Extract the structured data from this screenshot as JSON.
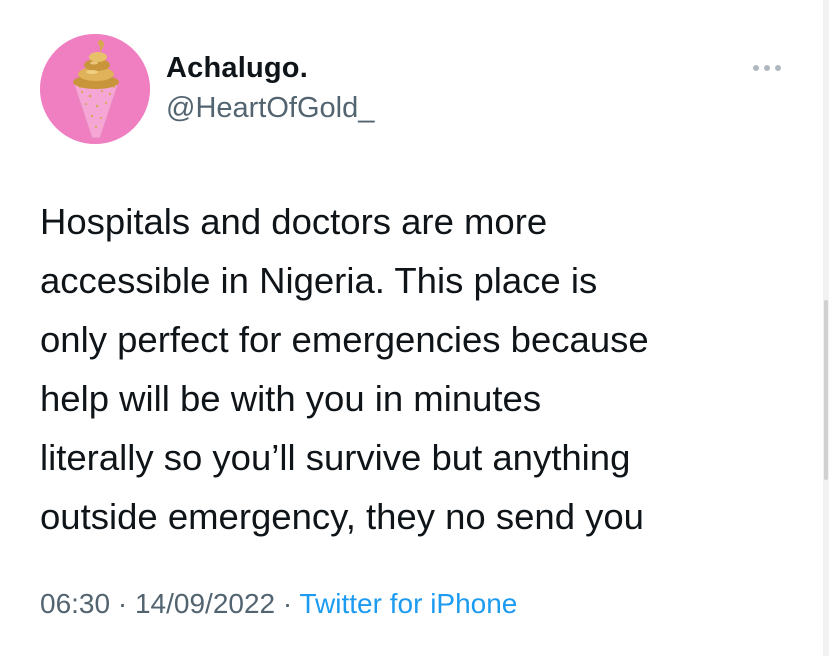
{
  "tweet": {
    "author": {
      "display_name": "Achalugo.",
      "handle": "@HeartOfGold_",
      "avatar_icon": "ice-cream-cone-avatar-icon"
    },
    "more_icon": "more-options-icon",
    "text_lines": [
      "Hospitals and doctors are more",
      "accessible in Nigeria. This place is",
      "only perfect for emergencies because",
      "help will be with you in minutes",
      "literally so you’ll survive but anything",
      "outside emergency, they no send you"
    ],
    "time": "06:30",
    "separator": "·",
    "date": "14/09/2022",
    "source": "Twitter for iPhone"
  },
  "colors": {
    "text": "#0f1419",
    "secondary": "#536471",
    "link": "#1d9bf0",
    "avatar_bg": "#f07fc2"
  }
}
